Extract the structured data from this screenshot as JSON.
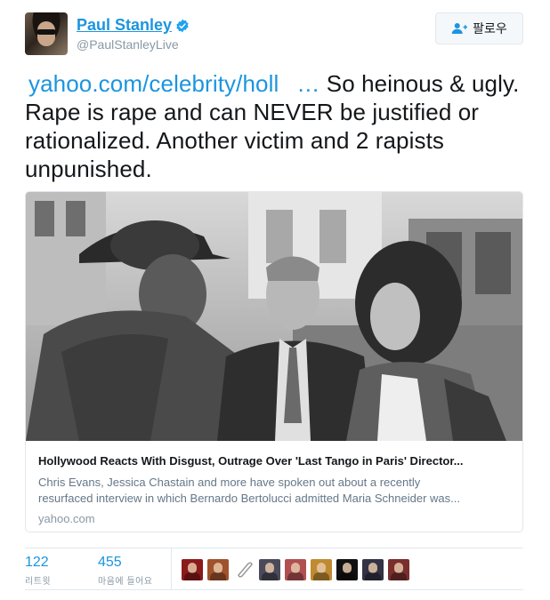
{
  "author": {
    "display_name": "Paul Stanley",
    "handle": "@PaulStanleyLive",
    "verified": true,
    "avatar_icon": "profile-photo"
  },
  "follow_button": {
    "label": "팔로우",
    "icon": "add-user-icon"
  },
  "tweet": {
    "link_text": "yahoo.com/celebrity/holl",
    "ellipsis": "…",
    "body": " So heinous & ugly. Rape is rape and can NEVER be justified or rationalized. Another victim and 2 rapists unpunished."
  },
  "card": {
    "title": "Hollywood Reacts With Disgust, Outrage Over 'Last Tango in Paris' Director...",
    "description_line1": "Chris Evans, Jessica Chastain and more have spoken out about a recently",
    "description_line2": "resurfaced interview in which Bernardo Bertolucci admitted Maria Schneider was...",
    "domain": "yahoo.com",
    "image_icon": "article-photo"
  },
  "stats": {
    "retweets": {
      "count": "122",
      "label": "리트윗"
    },
    "likes": {
      "count": "455",
      "label": "마음에 들어요"
    }
  },
  "likers": [
    {
      "name": "liker-avatar-1",
      "color": "#8b1a1a"
    },
    {
      "name": "liker-avatar-2",
      "color": "#a0522d"
    },
    {
      "name": "liker-avatar-3",
      "color": "#ffffff"
    },
    {
      "name": "liker-avatar-4",
      "color": "#4a4a5a"
    },
    {
      "name": "liker-avatar-5",
      "color": "#b05050"
    },
    {
      "name": "liker-avatar-6",
      "color": "#c08a30"
    },
    {
      "name": "liker-avatar-7",
      "color": "#111111"
    },
    {
      "name": "liker-avatar-8",
      "color": "#333344"
    },
    {
      "name": "liker-avatar-9",
      "color": "#7a2e2e"
    }
  ],
  "colors": {
    "link": "#1b95e0",
    "text": "#14171a",
    "muted": "#8899a6",
    "border": "#e1e8ed"
  }
}
